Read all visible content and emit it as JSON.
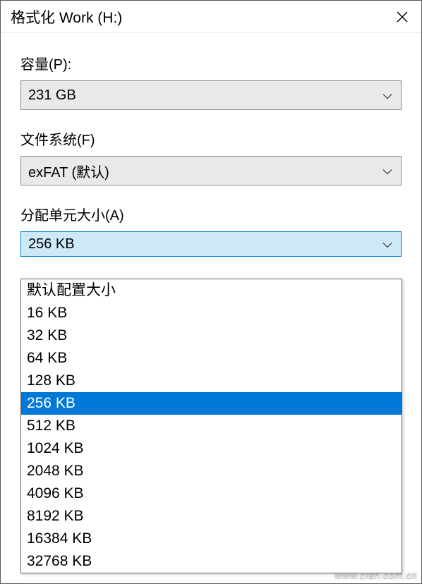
{
  "window": {
    "title": "格式化 Work (H:)"
  },
  "capacity": {
    "label": "容量(P):",
    "value": "231 GB"
  },
  "filesystem": {
    "label": "文件系统(F)",
    "value": "exFAT (默认)"
  },
  "allocation": {
    "label": "分配单元大小(A)",
    "value": "256 KB",
    "options": [
      "默认配置大小",
      "16 KB",
      "32 KB",
      "64 KB",
      "128 KB",
      "256 KB",
      "512 KB",
      "1024 KB",
      "2048 KB",
      "4096 KB",
      "8192 KB",
      "16384 KB",
      "32768 KB"
    ],
    "selected_index": 5
  },
  "watermark": "www.cfan.com.cn"
}
